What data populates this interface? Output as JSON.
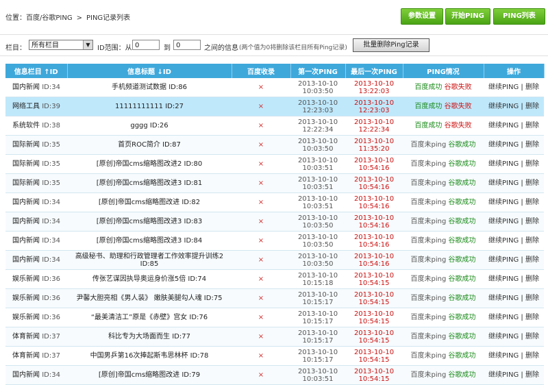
{
  "breadcrumb": {
    "prefix": "位置：百度/谷歌PING",
    "sep": ">",
    "current": "PING记录列表"
  },
  "top_buttons": [
    {
      "label": "参数设置"
    },
    {
      "label": "开始PING"
    },
    {
      "label": "PING列表"
    }
  ],
  "filter": {
    "column_label": "栏目：",
    "column_value": "所有栏目",
    "range_label": "ID范围：从",
    "from_value": "0",
    "to_label": "到",
    "to_value": "0",
    "between_label": "之间的信息",
    "hint": "(两个值为0将删除该栏目所有Ping记录)",
    "batch_delete": "批量删除Ping记录"
  },
  "table": {
    "headers": [
      "信息栏目 ↑ID",
      "信息标题 ↓ID",
      "百度收录",
      "第一次PING",
      "最后一次PING",
      "PING情况",
      "操作"
    ],
    "rows": [
      {
        "cat": "国内新闻",
        "catid": "ID:34",
        "title": "手机频道测试数据 ID:86",
        "t1a": "2013-10-10",
        "t1b": "10:03:50",
        "t2a": "2013-10-10",
        "t2b": "13:22:03",
        "s1": "百度成功",
        "s2": "谷歌失败"
      },
      {
        "cat": "网络工具",
        "catid": "ID:39",
        "title": "11111111111 ID:27",
        "t1a": "2013-10-10",
        "t1b": "12:23:03",
        "t2a": "2013-10-10",
        "t2b": "12:23:03",
        "s1": "百度成功",
        "s2": "谷歌失败"
      },
      {
        "cat": "系统软件",
        "catid": "ID:38",
        "title": "gggg ID:26",
        "t1a": "2013-10-10",
        "t1b": "12:22:34",
        "t2a": "2013-10-10",
        "t2b": "12:22:34",
        "s1": "百度成功",
        "s2": "谷歌失败"
      },
      {
        "cat": "国际新闻",
        "catid": "ID:35",
        "title": "首页ROC简介 ID:87",
        "t1a": "2013-10-10",
        "t1b": "10:03:50",
        "t2a": "2013-10-10",
        "t2b": "11:35:20",
        "s1": "百度未ping",
        "s2": "谷歌成功"
      },
      {
        "cat": "国际新闻",
        "catid": "ID:35",
        "title": "[原创]帝国cms缩略图改进2 ID:80",
        "t1a": "2013-10-10",
        "t1b": "10:03:51",
        "t2a": "2013-10-10",
        "t2b": "10:54:16",
        "s1": "百度未ping",
        "s2": "谷歌成功"
      },
      {
        "cat": "国际新闻",
        "catid": "ID:35",
        "title": "[原创]帝国cms缩略图改进3 ID:81",
        "t1a": "2013-10-10",
        "t1b": "10:03:51",
        "t2a": "2013-10-10",
        "t2b": "10:54:16",
        "s1": "百度未ping",
        "s2": "谷歌成功"
      },
      {
        "cat": "国内新闻",
        "catid": "ID:34",
        "title": "[原创]帝国cms缩略图改进 ID:82",
        "t1a": "2013-10-10",
        "t1b": "10:03:51",
        "t2a": "2013-10-10",
        "t2b": "10:54:16",
        "s1": "百度未ping",
        "s2": "谷歌成功"
      },
      {
        "cat": "国内新闻",
        "catid": "ID:34",
        "title": "[原创]帝国cms缩略图改进3 ID:83",
        "t1a": "2013-10-10",
        "t1b": "10:03:50",
        "t2a": "2013-10-10",
        "t2b": "10:54:16",
        "s1": "百度未ping",
        "s2": "谷歌成功"
      },
      {
        "cat": "国内新闻",
        "catid": "ID:34",
        "title": "[原创]帝国cms缩略图改进3 ID:84",
        "t1a": "2013-10-10",
        "t1b": "10:03:50",
        "t2a": "2013-10-10",
        "t2b": "10:54:16",
        "s1": "百度未ping",
        "s2": "谷歌成功"
      },
      {
        "cat": "国内新闻",
        "catid": "ID:34",
        "title": "高级秘书、助理和行政管理者工作效率提升训练2 ID:85",
        "t1a": "2013-10-10",
        "t1b": "10:03:50",
        "t2a": "2013-10-10",
        "t2b": "10:54:16",
        "s1": "百度未ping",
        "s2": "谷歌成功"
      },
      {
        "cat": "娱乐新闻",
        "catid": "ID:36",
        "title": "传张艺谋因执导奥运身价涨5倍 ID:74",
        "t1a": "2013-10-10",
        "t1b": "10:15:18",
        "t2a": "2013-10-10",
        "t2b": "10:54:15",
        "s1": "百度未ping",
        "s2": "谷歌成功"
      },
      {
        "cat": "娱乐新闻",
        "catid": "ID:36",
        "title": "尹馨大胆亮相《男人装》 嫩肤美腿勾人魂 ID:75",
        "t1a": "2013-10-10",
        "t1b": "10:15:17",
        "t2a": "2013-10-10",
        "t2b": "10:54:15",
        "s1": "百度未ping",
        "s2": "谷歌成功"
      },
      {
        "cat": "娱乐新闻",
        "catid": "ID:36",
        "title": "“最美清洁工”原是《赤壁》宫女 ID:76",
        "t1a": "2013-10-10",
        "t1b": "10:15:17",
        "t2a": "2013-10-10",
        "t2b": "10:54:15",
        "s1": "百度未ping",
        "s2": "谷歌成功"
      },
      {
        "cat": "体育新闻",
        "catid": "ID:37",
        "title": "科比专为大场面而生 ID:77",
        "t1a": "2013-10-10",
        "t1b": "10:15:17",
        "t2a": "2013-10-10",
        "t2b": "10:54:15",
        "s1": "百度未ping",
        "s2": "谷歌成功"
      },
      {
        "cat": "体育新闻",
        "catid": "ID:37",
        "title": "中国男乒第16次捧起斯韦思林杯 ID:78",
        "t1a": "2013-10-10",
        "t1b": "10:15:17",
        "t2a": "2013-10-10",
        "t2b": "10:54:15",
        "s1": "百度未ping",
        "s2": "谷歌成功"
      },
      {
        "cat": "国内新闻",
        "catid": "ID:34",
        "title": "[原创]帝国cms缩略图改进 ID:79",
        "t1a": "2013-10-10",
        "t1b": "10:03:51",
        "t2a": "2013-10-10",
        "t2b": "10:54:15",
        "s1": "百度未ping",
        "s2": "谷歌成功"
      }
    ],
    "baidu_mark": "×",
    "action_continue": "继续PING",
    "action_sep": "|",
    "action_delete": "删除",
    "highlight_row": 1
  },
  "colors": {
    "header_bg": "#3fa8db",
    "highlight_bg": "#bfe8fb",
    "button_green": "#4aa414",
    "fail_red": "#cc1111",
    "ok_green": "#1a8a1a"
  }
}
